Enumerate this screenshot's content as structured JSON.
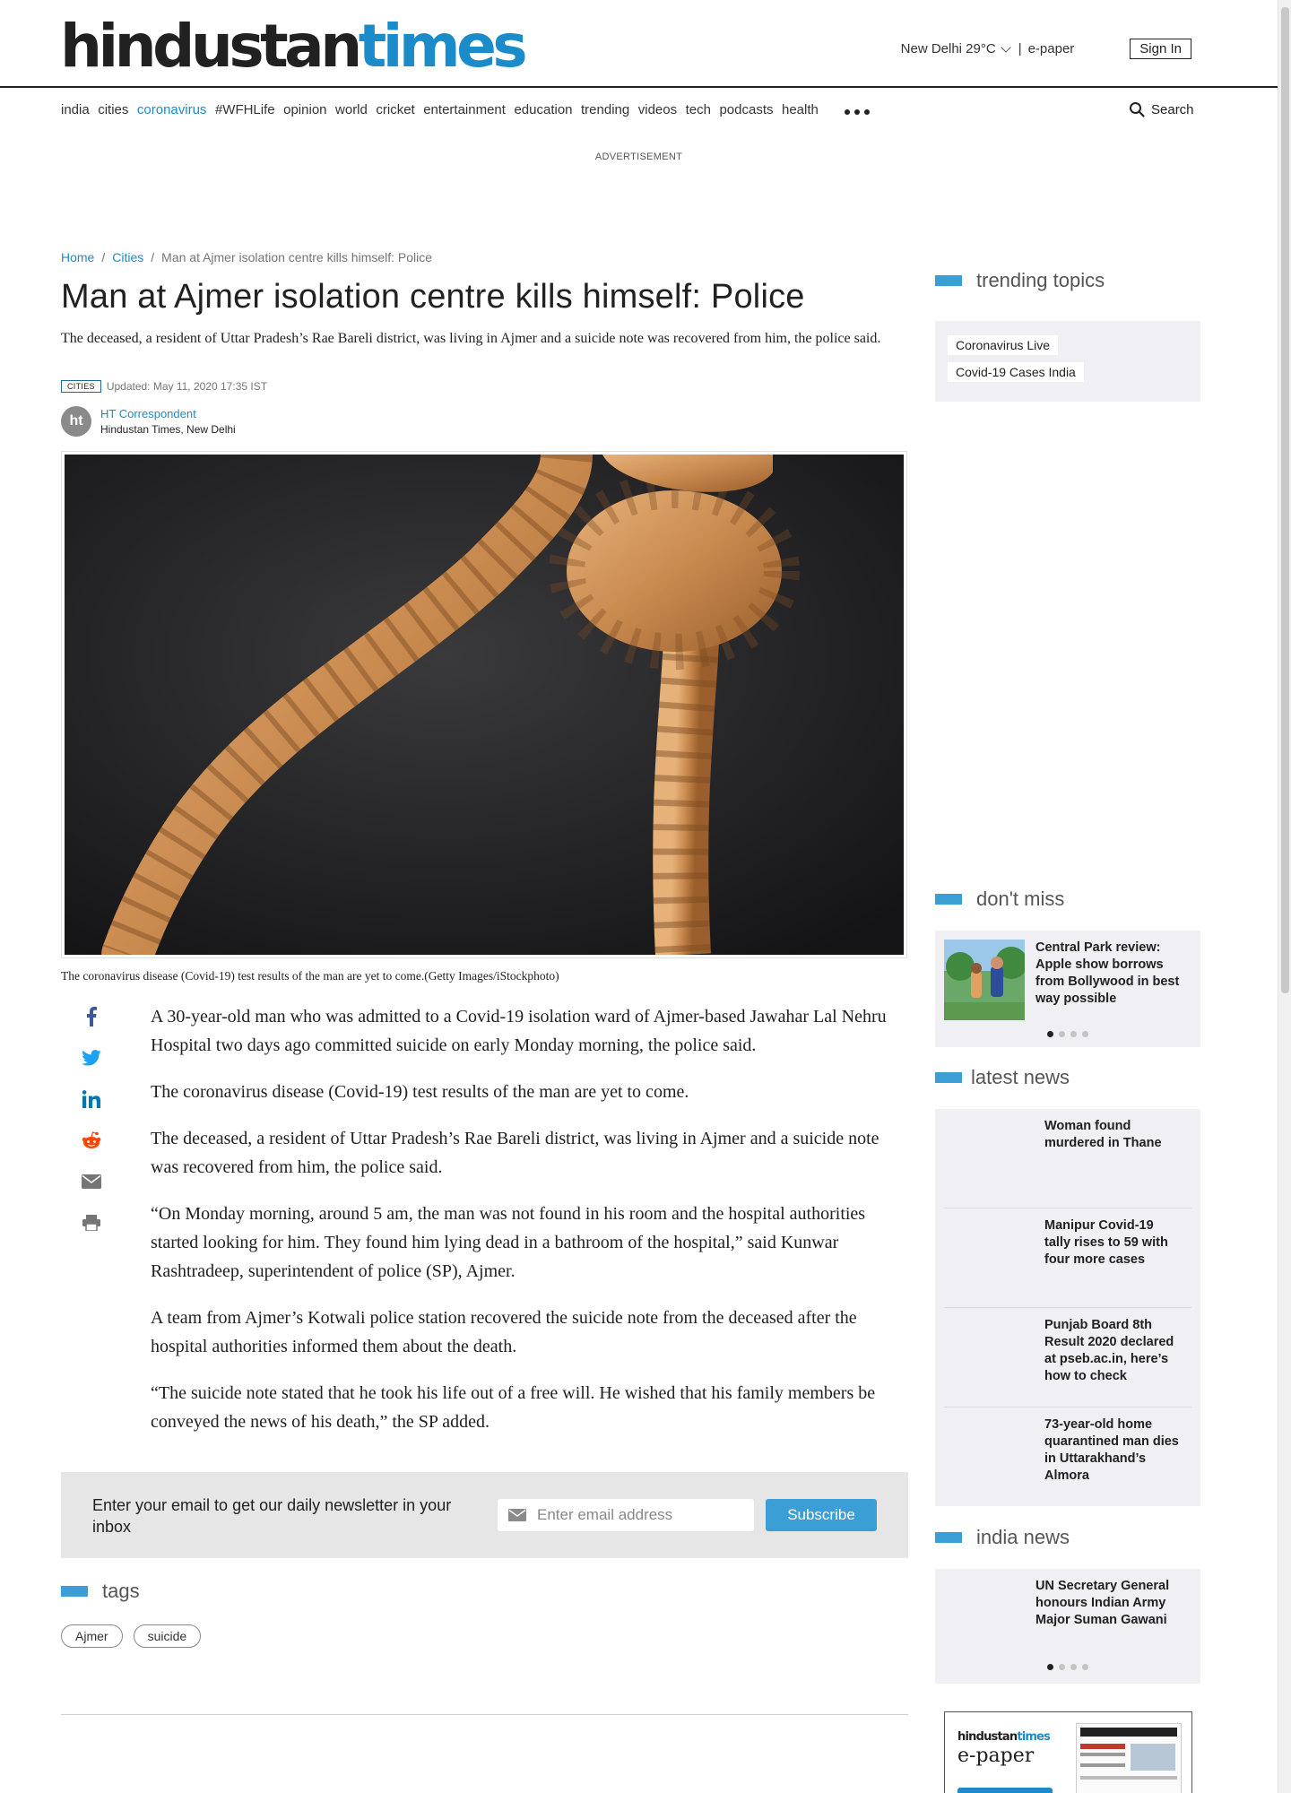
{
  "header": {
    "logo_part1": "hindustan",
    "logo_part2": "times",
    "weather": "New Delhi 29°C",
    "separator": "|",
    "epaper": "e-paper",
    "signin": "Sign In"
  },
  "nav": {
    "items": [
      "india",
      "cities",
      "coronavirus",
      "#WFHLife",
      "opinion",
      "world",
      "cricket",
      "entertainment",
      "education",
      "trending",
      "videos",
      "tech",
      "podcasts",
      "health"
    ],
    "active": "coronavirus",
    "search_label": "Search"
  },
  "advertisement_label": "ADVERTISEMENT",
  "breadcrumb": {
    "home": "Home",
    "sep": "/",
    "section": "Cities",
    "current": "Man at Ajmer isolation centre kills himself: Police"
  },
  "article": {
    "title": "Man at Ajmer isolation centre kills himself: Police",
    "summary": "The deceased, a resident of Uttar Pradesh’s Rae Bareli district, was living in Ajmer and a suicide note was recovered from him, the police said.",
    "section_tag": "CITIES",
    "updated": "Updated: May 11, 2020 17:35 IST",
    "author_initials": "ht",
    "author": "HT Correspondent",
    "publication": "Hindustan Times, New Delhi",
    "caption": "The coronavirus disease (Covid-19) test results of the man are yet to come.(Getty Images/iStockphoto)",
    "paragraphs": [
      "A 30-year-old man who was admitted to a Covid-19 isolation ward of Ajmer-based Jawahar Lal Nehru Hospital two days ago committed suicide on early Monday morning, the police said.",
      "The coronavirus disease (Covid-19) test results of the man are yet to come.",
      "The deceased, a resident of Uttar Pradesh’s Rae Bareli district, was living in Ajmer and a suicide note was recovered from him, the police said.",
      "“On Monday morning, around 5 am, the man was not found in his room and the hospital authorities started looking for him. They found him lying dead in a bathroom of the hospital,” said Kunwar Rashtradeep, superintendent of police (SP), Ajmer.",
      "A team from Ajmer’s Kotwali police station recovered the suicide note from the deceased after the hospital authorities informed them about the death.",
      "“The suicide note stated that he took his life out of a free will. He wished that his family members be conveyed the news of his death,” the SP added."
    ]
  },
  "share_icons": [
    "facebook-icon",
    "twitter-icon",
    "linkedin-icon",
    "reddit-icon",
    "email-icon",
    "print-icon"
  ],
  "newsletter": {
    "text": "Enter your email to get our daily newsletter in your inbox",
    "placeholder": "Enter email address",
    "button": "Subscribe"
  },
  "tags": {
    "heading": "tags",
    "items": [
      "Ajmer",
      "suicide"
    ]
  },
  "sidebar": {
    "trending": {
      "heading": "trending topics",
      "items": [
        "Coronavirus Live",
        "Covid-19 Cases India"
      ]
    },
    "dont_miss": {
      "heading": "don't miss",
      "story": "Central Park review: Apple show borrows from Bollywood in best way possible"
    },
    "latest_news": {
      "heading": "latest news",
      "items": [
        "Woman found murdered in Thane",
        "Manipur Covid-19 tally rises to 59 with four more cases",
        "Punjab Board 8th Result 2020 declared at pseb.ac.in, here’s how to check",
        "73-year-old home quarantined man dies in Uttarakhand’s Almora"
      ]
    },
    "india_news": {
      "heading": "india news",
      "story": "UN Secretary General honours Indian Army Major Suman Gawani"
    },
    "epaper": {
      "logo_part1": "hindustan",
      "logo_part2": "times",
      "label": "e-paper"
    }
  },
  "colors": {
    "brand_blue": "#1b8bc9",
    "accent_bar": "#3b9fd6",
    "text": "#212121"
  }
}
